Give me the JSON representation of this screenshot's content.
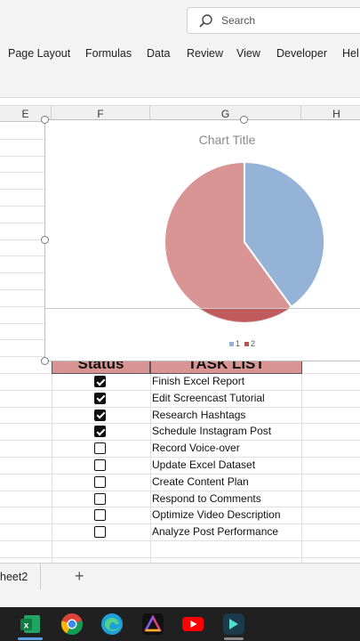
{
  "search": {
    "label": "Search"
  },
  "menu": {
    "items": [
      "Page Layout",
      "Formulas",
      "Data",
      "Review",
      "View",
      "Developer",
      "Hel"
    ]
  },
  "columns": [
    "E",
    "F",
    "G",
    "H"
  ],
  "table": {
    "header_status": "Status",
    "header_tasks": "TASK LIST",
    "rows": [
      {
        "task": "Finish Excel Report",
        "done": true
      },
      {
        "task": "Edit Screencast Tutorial",
        "done": true
      },
      {
        "task": "Research Hashtags",
        "done": true
      },
      {
        "task": "Schedule Instagram Post",
        "done": true
      },
      {
        "task": "Record Voice-over",
        "done": false
      },
      {
        "task": "Update Excel Dataset",
        "done": false
      },
      {
        "task": "Create Content Plan",
        "done": false
      },
      {
        "task": "Respond to Comments",
        "done": false
      },
      {
        "task": "Optimize Video Description",
        "done": false
      },
      {
        "task": "Analyze Post Performance",
        "done": false
      }
    ]
  },
  "chart_data": {
    "type": "pie",
    "title": "Chart Title",
    "categories": [
      "1",
      "2"
    ],
    "values": [
      4,
      6
    ],
    "colors": [
      "#95b3d7",
      "#d99594"
    ],
    "legend": {
      "entries": [
        "1",
        "2"
      ],
      "placement": "bottom"
    }
  },
  "sheets": {
    "active_tab": "heet2",
    "add_icon": "+"
  },
  "taskbar": {
    "icons": [
      "excel-icon",
      "chrome-icon",
      "edge-icon",
      "affinity-icon",
      "youtube-icon",
      "clipchamp-icon"
    ]
  }
}
